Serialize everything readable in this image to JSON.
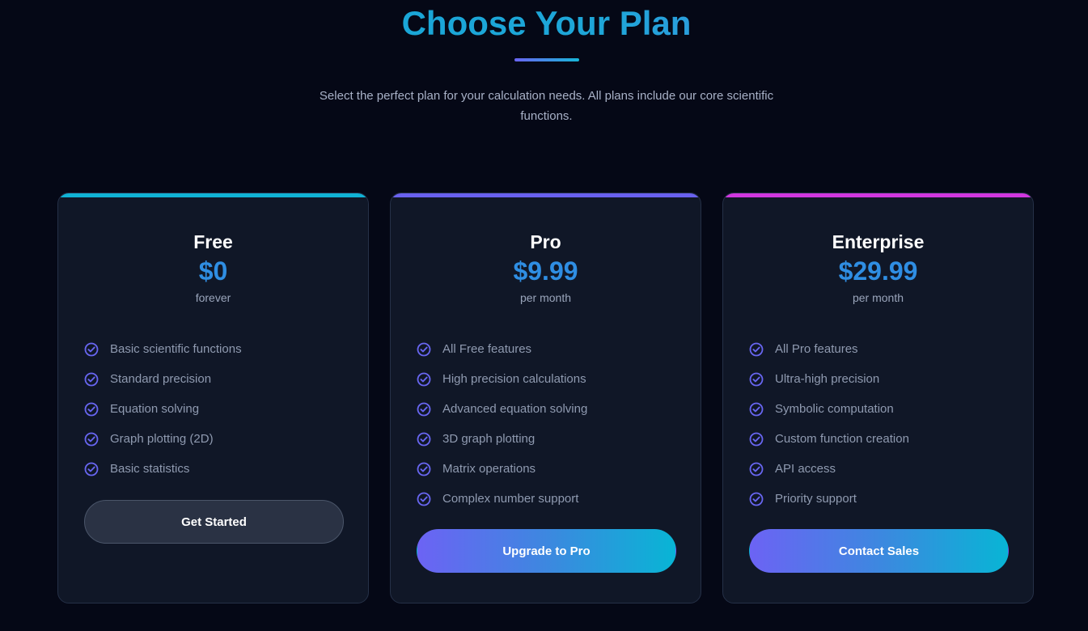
{
  "header": {
    "title": "Choose Your Plan",
    "subtitle": "Select the perfect plan for your calculation needs. All plans include our core scientific functions."
  },
  "theme": {
    "background": "#050816",
    "card_background": "#101727",
    "accent_blue": "#2f8ee3",
    "gradient_start": "#6c63f4",
    "gradient_end": "#08b5d5",
    "free_accent": "#10b2d5",
    "pro_accent": "#6961ef",
    "enterprise_accent": "#d037df"
  },
  "plans": [
    {
      "name": "Free",
      "price": "$0",
      "period": "forever",
      "features": [
        "Basic scientific functions",
        "Standard precision",
        "Equation solving",
        "Graph plotting (2D)",
        "Basic statistics"
      ],
      "cta": "Get Started",
      "feature_icon": "check-circle-icon"
    },
    {
      "name": "Pro",
      "price": "$9.99",
      "period": "per month",
      "features": [
        "All Free features",
        "High precision calculations",
        "Advanced equation solving",
        "3D graph plotting",
        "Matrix operations",
        "Complex number support"
      ],
      "cta": "Upgrade to Pro",
      "feature_icon": "check-circle-icon"
    },
    {
      "name": "Enterprise",
      "price": "$29.99",
      "period": "per month",
      "features": [
        "All Pro features",
        "Ultra-high precision",
        "Symbolic computation",
        "Custom function creation",
        "API access",
        "Priority support"
      ],
      "cta": "Contact Sales",
      "feature_icon": "check-circle-icon"
    }
  ]
}
